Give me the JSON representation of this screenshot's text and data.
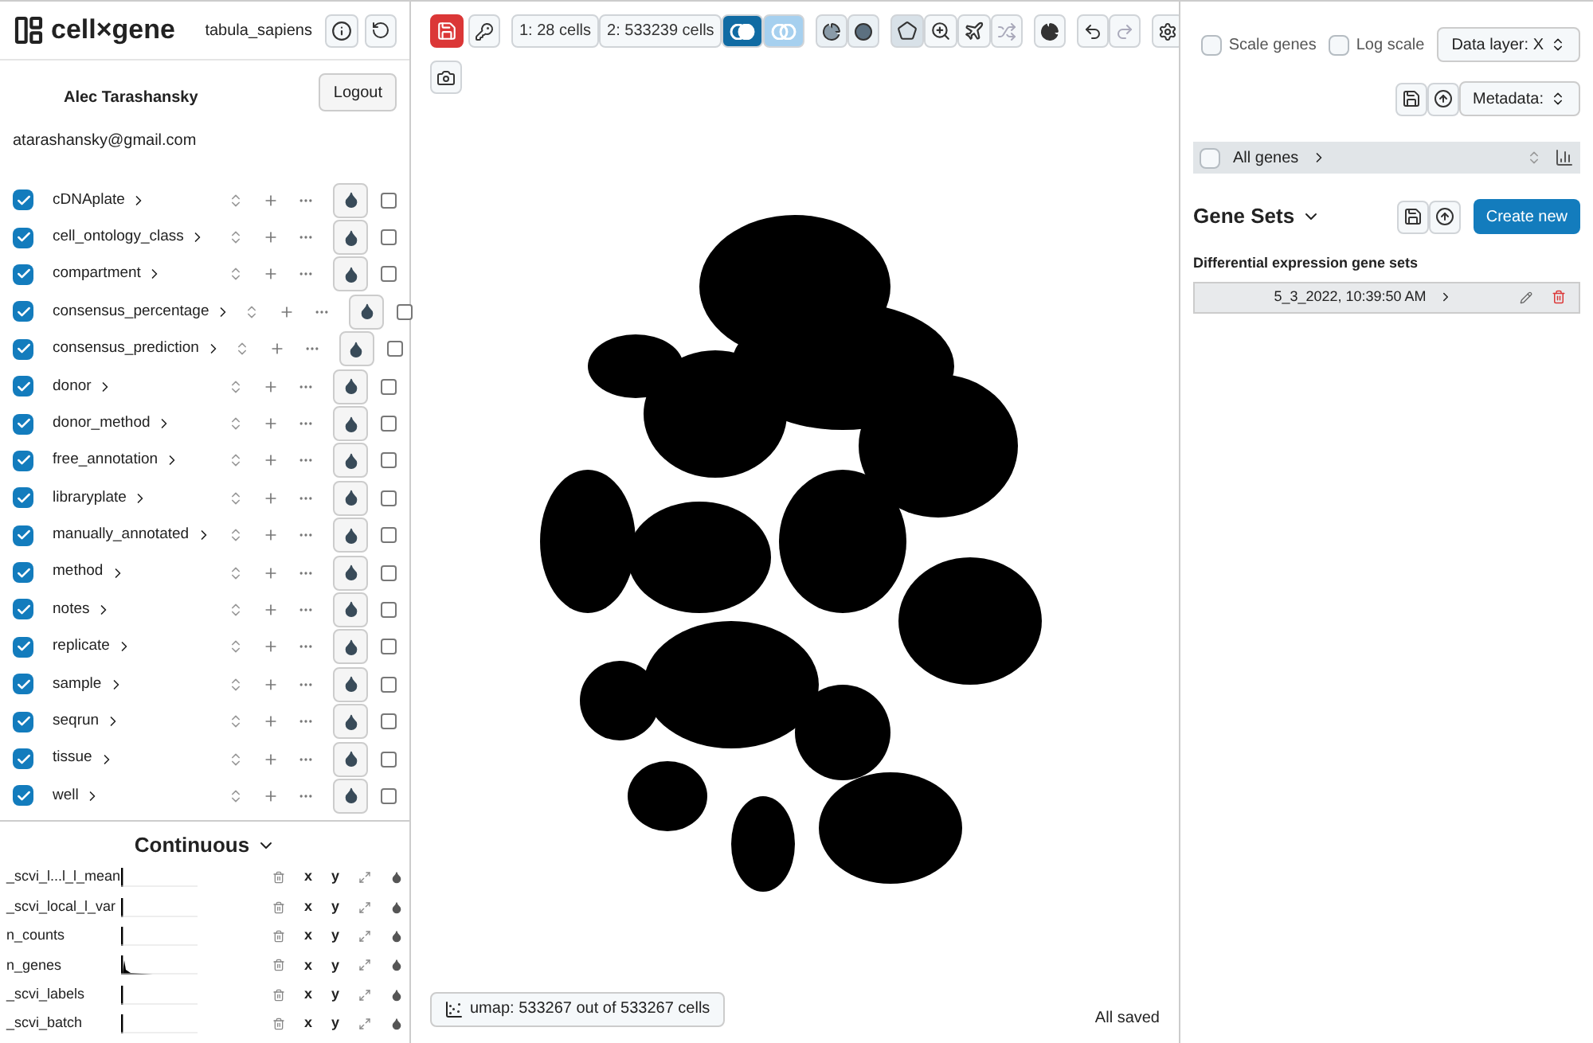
{
  "header": {
    "logo": "cell×gene",
    "dataset": "tabula_sapiens"
  },
  "user": {
    "name": "Alec Tarashansky",
    "email": "atarashansky@gmail.com",
    "logout": "Logout"
  },
  "categorical": [
    {
      "name": "cDNAplate",
      "checked": true,
      "selected": false,
      "on": false
    },
    {
      "name": "cell_ontology_class",
      "checked": true,
      "selected": false,
      "on": false
    },
    {
      "name": "compartment",
      "checked": true,
      "selected": false,
      "on": false
    },
    {
      "name": "consensus_percentage",
      "checked": true,
      "selected": false,
      "on": false
    },
    {
      "name": "consensus_prediction",
      "checked": true,
      "selected": false,
      "on": false
    },
    {
      "name": "donor",
      "checked": true,
      "selected": false,
      "on": false
    },
    {
      "name": "donor_method",
      "checked": true,
      "selected": false,
      "on": false
    },
    {
      "name": "free_annotation",
      "checked": true,
      "selected": false,
      "on": false
    },
    {
      "name": "libraryplate",
      "checked": true,
      "selected": false,
      "on": false
    },
    {
      "name": "manually_annotated",
      "checked": true,
      "selected": false,
      "on": false
    },
    {
      "name": "method",
      "checked": true,
      "selected": false,
      "on": false
    },
    {
      "name": "notes",
      "checked": true,
      "selected": false,
      "on": false
    },
    {
      "name": "replicate",
      "checked": true,
      "selected": false,
      "on": false
    },
    {
      "name": "sample",
      "checked": true,
      "selected": false,
      "on": false
    },
    {
      "name": "seqrun",
      "checked": true,
      "selected": false,
      "on": false
    },
    {
      "name": "tissue",
      "checked": true,
      "selected": false,
      "on": false
    },
    {
      "name": "well",
      "checked": true,
      "selected": false,
      "on": false
    }
  ],
  "continuous": {
    "title": "Continuous",
    "items": [
      {
        "name": "_scvi_l...l_l_mean",
        "x": "x",
        "y": "y",
        "kind": "flat"
      },
      {
        "name": "_scvi_local_l_var",
        "x": "x",
        "y": "y",
        "kind": "flat"
      },
      {
        "name": "n_counts",
        "x": "x",
        "y": "y",
        "kind": "flat"
      },
      {
        "name": "n_genes",
        "x": "x",
        "y": "y",
        "kind": "peak"
      },
      {
        "name": "_scvi_labels",
        "x": "x",
        "y": "y",
        "kind": "flat"
      },
      {
        "name": "_scvi_batch",
        "x": "x",
        "y": "y",
        "kind": "flat"
      }
    ]
  },
  "toolbar": {
    "cellsets": [
      {
        "label": "1: 28 cells"
      },
      {
        "label": "2: 533239 cells"
      }
    ],
    "venn": [
      {
        "selected": true
      },
      {
        "selected": false
      }
    ],
    "tools": [
      {
        "kind": "lasso",
        "selected": true,
        "disabled": false
      },
      {
        "kind": "zoom",
        "selected": false,
        "disabled": false
      },
      {
        "kind": "pan",
        "selected": false,
        "disabled": false
      },
      {
        "kind": "reset",
        "selected": false,
        "disabled": true
      }
    ],
    "undo_disabled": false,
    "redo_disabled": true
  },
  "embedding": {
    "label": "umap: 533267 out of 533267 cells",
    "status": "All saved"
  },
  "right": {
    "scale_genes": {
      "label": "Scale genes",
      "checked": false
    },
    "log_scale": {
      "label": "Log scale",
      "checked": false
    },
    "data_layer": "Data layer: X",
    "metadata": "Metadata:",
    "all_genes": {
      "label": "All genes",
      "checked": false
    },
    "gene_sets_title": "Gene Sets",
    "create_new": "Create new",
    "de_title": "Differential expression gene sets",
    "gene_sets": [
      {
        "name": "5_3_2022, 10:39:50 AM"
      }
    ]
  }
}
